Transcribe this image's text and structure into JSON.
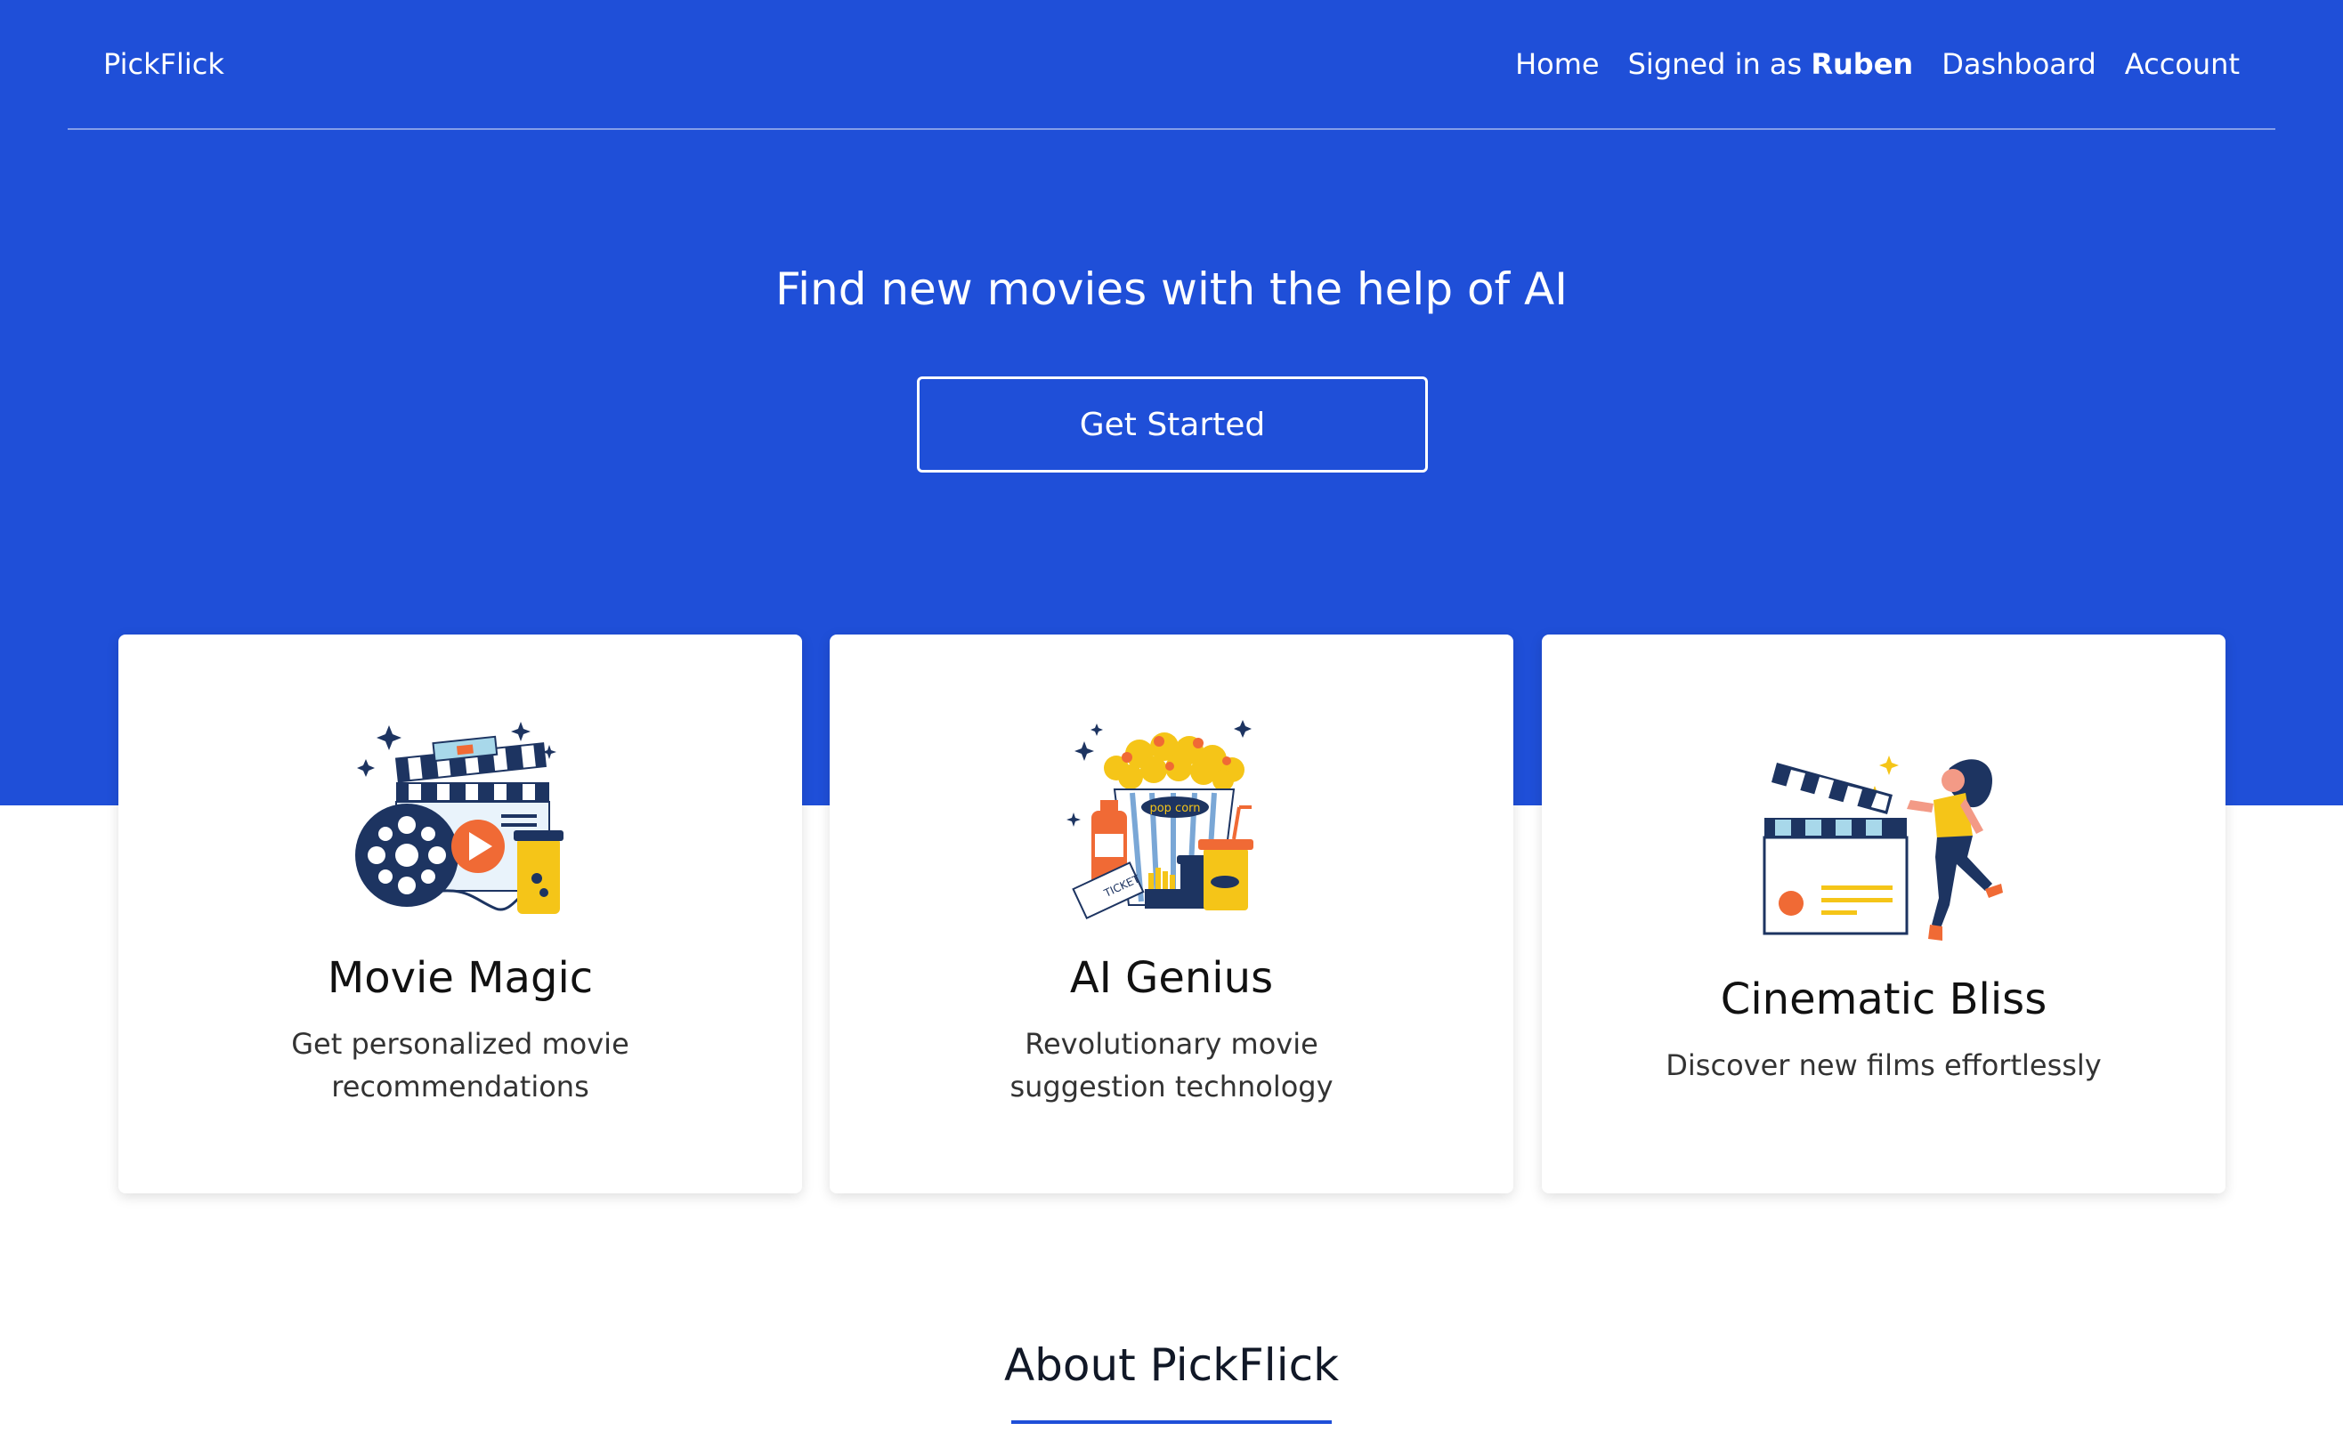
{
  "nav": {
    "brand": "PickFlick",
    "home": "Home",
    "signed_in_prefix": "Signed in as",
    "user_name": "Ruben",
    "dashboard": "Dashboard",
    "account": "Account"
  },
  "hero": {
    "title": "Find new movies with the help of AI",
    "cta": "Get Started"
  },
  "features": [
    {
      "title": "Movie Magic",
      "description": "Get personalized movie recommendations",
      "icon": "film-reel-illustration"
    },
    {
      "title": "AI Genius",
      "description": "Revolutionary movie suggestion technology",
      "icon": "popcorn-snacks-illustration"
    },
    {
      "title": "Cinematic Bliss",
      "description": "Discover new films effortlessly",
      "icon": "clapperboard-woman-illustration"
    }
  ],
  "about": {
    "title": "About PickFlick"
  },
  "colors": {
    "primary": "#1f4fd8",
    "text_dark": "#111827",
    "accent_yellow": "#f5c518",
    "accent_orange": "#f06a35",
    "navy": "#1d3461"
  }
}
